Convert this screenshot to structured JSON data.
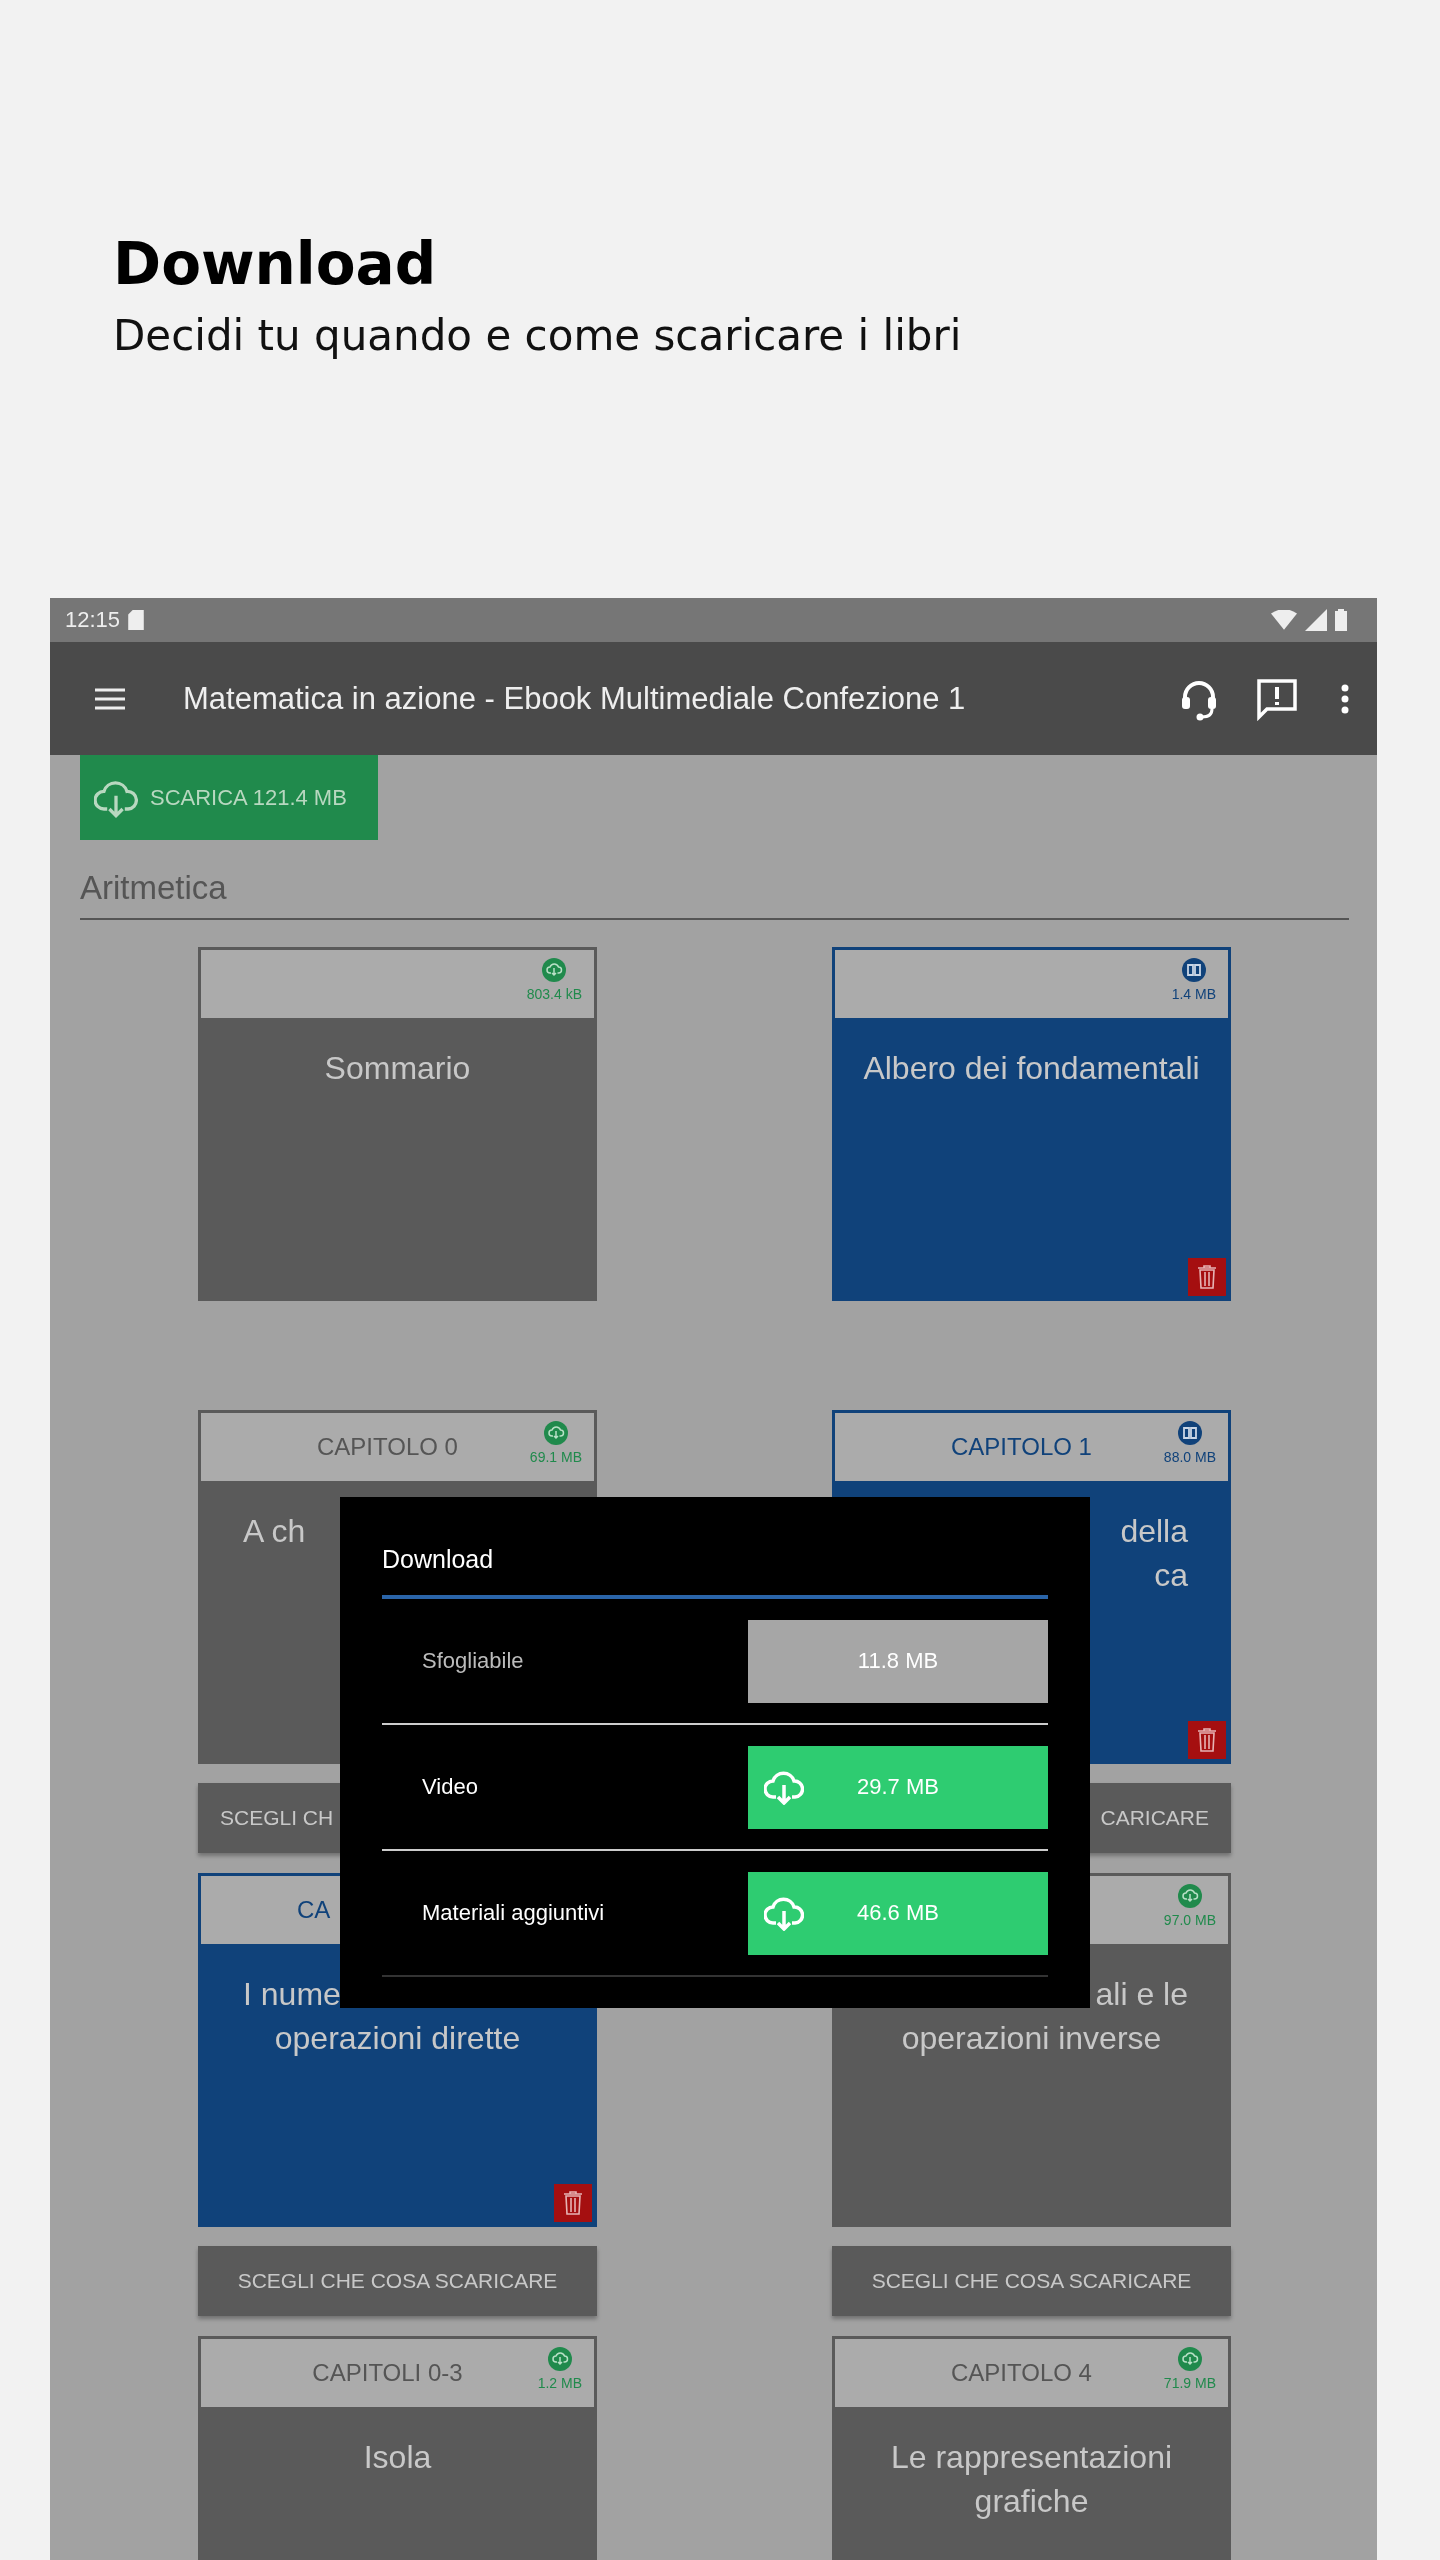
{
  "page": {
    "title": "Download",
    "subtitle": "Decidi tu quando e come scaricare i libri"
  },
  "status_bar": {
    "time": "12:15"
  },
  "app_bar": {
    "title": "Matematica in azione - Ebook Multimediale Confezione 1"
  },
  "download_all": {
    "label": "SCARICA 121.4 MB"
  },
  "section": {
    "title": "Aritmetica"
  },
  "cards": [
    {
      "size": "803.4 kB",
      "downloaded": false,
      "title_lines": [
        {
          "text": "Sommario",
          "covered": false
        }
      ]
    },
    {
      "size": "1.4 MB",
      "downloaded": true,
      "title_lines": [
        {
          "text": "Albero dei fondamentali",
          "covered": false
        }
      ]
    },
    {
      "header": "CAPITOLO 0",
      "header_covered": false,
      "size": "69.1 MB",
      "downloaded": false,
      "title_lines": [
        {
          "text": "A ch",
          "covered": true
        }
      ],
      "button": {
        "label": "SCEGLI CH",
        "covered": true
      }
    },
    {
      "header": "CAPITOLO 1",
      "header_covered": false,
      "size": "88.0 MB",
      "downloaded": true,
      "title_lines": [
        {
          "text": "della",
          "covered": true
        },
        {
          "text": "ca",
          "covered": true
        }
      ],
      "button": {
        "label": "CARICARE",
        "covered": true
      }
    },
    {
      "header": "CA",
      "header_covered": true,
      "downloaded": true,
      "title_lines": [
        {
          "text": "I nume",
          "covered": true
        },
        {
          "text": "operazioni dirette",
          "covered": false
        }
      ],
      "button": {
        "label": "SCEGLI CHE COSA SCARICARE",
        "covered": false
      }
    },
    {
      "size": "97.0 MB",
      "downloaded": false,
      "title_lines": [
        {
          "text": "ali e le",
          "covered": true
        },
        {
          "text": "operazioni inverse",
          "covered": false
        }
      ],
      "button": {
        "label": "SCEGLI CHE COSA SCARICARE",
        "covered": false
      }
    },
    {
      "header": "CAPITOLI 0-3",
      "header_covered": false,
      "size": "1.2 MB",
      "downloaded": false,
      "title_lines": [
        {
          "text": "Isola",
          "covered": false
        }
      ]
    },
    {
      "header": "CAPITOLO 4",
      "header_covered": false,
      "size": "71.9 MB",
      "downloaded": false,
      "title_lines": [
        {
          "text": "Le rappresentazioni",
          "covered": false
        },
        {
          "text": "grafiche",
          "covered": false
        }
      ]
    }
  ],
  "dialog": {
    "title": "Download",
    "options": [
      {
        "label": "Sfogliabile",
        "size": "11.8 MB",
        "available": false
      },
      {
        "label": "Video",
        "size": "29.7 MB",
        "available": true
      },
      {
        "label": "Materiali aggiuntivi",
        "size": "46.6 MB",
        "available": true
      }
    ]
  }
}
